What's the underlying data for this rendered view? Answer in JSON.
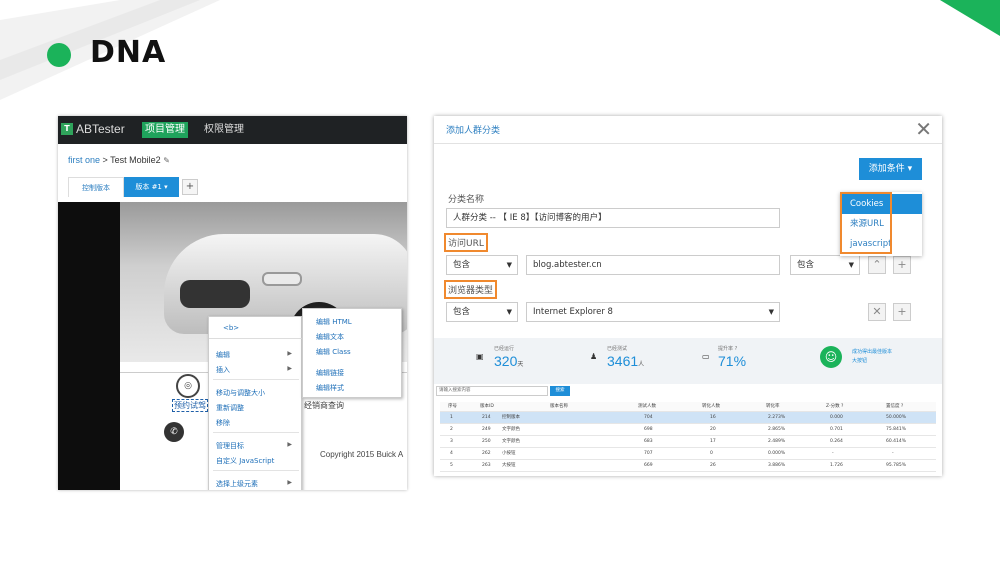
{
  "slide": {
    "title": "DNA"
  },
  "colors": {
    "accent_green": "#1bb35a",
    "accent_blue": "#1e8ed8",
    "highlight_orange": "#f0892e"
  },
  "left_app": {
    "logo": "ABTester",
    "nav": {
      "active": "项目管理",
      "other": "权限管理"
    },
    "breadcrumb": {
      "link": "first one",
      "separator": ">",
      "current": "Test Mobile2"
    },
    "tabs": {
      "control": "控制版本",
      "version": "版本 #1 ▾",
      "add": "+"
    },
    "page": {
      "link_selected": "预约试驾",
      "link_dealer": "经销商查询",
      "copyright": "Copyright 2015 Buick A"
    },
    "context_menu": {
      "header": "<b>",
      "items": [
        "编辑",
        "插入",
        "移动与调整大小",
        "重新调整",
        "移除",
        "管理目标",
        "自定义 JavaScript",
        "选择上级元素"
      ]
    },
    "sub_menu": {
      "items": [
        "编辑 HTML",
        "编辑文本",
        "编辑 Class",
        "编辑链接",
        "编辑样式"
      ]
    }
  },
  "right_app": {
    "dialog_title": "添加人群分类",
    "add_condition": "添加条件 ▾",
    "condition_options": [
      "Cookies",
      "来源URL",
      "javascript"
    ],
    "name_label": "分类名称",
    "name_value": "人群分类 -- 【 IE 8】【访问博客的用户】",
    "url_label": "访问URL",
    "url_operator": "包含",
    "url_value": "blog.abtester.cn",
    "url_operator2": "包含",
    "browser_label": "浏览器类型",
    "browser_operator": "包含",
    "browser_value": "Internet Explorer 8",
    "stats": [
      {
        "caption": "已经运行",
        "value": "320",
        "unit": "天"
      },
      {
        "caption": "已经测试",
        "value": "3461",
        "unit": "人"
      },
      {
        "caption": "提升率 ?",
        "value": "71%",
        "unit": ""
      }
    ],
    "winner_line1": "成功得出最佳版本",
    "winner_line2": "大按钮",
    "search_placeholder": "请输入搜索内容",
    "search_button": "搜索",
    "table": {
      "headers": [
        "序号",
        "版本ID",
        "版本名称",
        "测试人数",
        "转化人数",
        "转化率",
        "Z-分数 ?",
        "置信度 ?"
      ],
      "rows": [
        [
          "1",
          "214",
          "控制版本",
          "704",
          "16",
          "2.273%",
          "0.000",
          "50.000%"
        ],
        [
          "2",
          "249",
          "文字颜色",
          "698",
          "20",
          "2.865%",
          "0.701",
          "75.841%"
        ],
        [
          "3",
          "250",
          "文字颜色",
          "683",
          "17",
          "2.489%",
          "0.264",
          "60.414%"
        ],
        [
          "4",
          "262",
          "小按钮",
          "707",
          "0",
          "0.000%",
          "-",
          "-"
        ],
        [
          "5",
          "263",
          "大按钮",
          "669",
          "26",
          "3.886%",
          "1.726",
          "95.785%"
        ]
      ]
    }
  }
}
